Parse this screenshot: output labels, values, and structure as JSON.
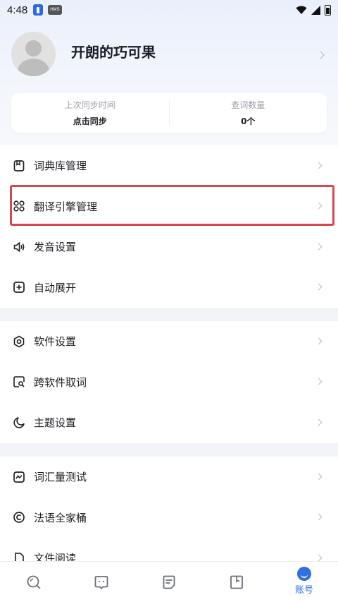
{
  "status_bar": {
    "time": "4:48",
    "hms_label": "HMS"
  },
  "profile": {
    "username": "开朗的巧可果"
  },
  "stats": [
    {
      "label": "上次同步时间",
      "value": "点击同步"
    },
    {
      "label": "查词数量",
      "value": "0个"
    }
  ],
  "section1": [
    {
      "label": "词典库管理",
      "icon": "book-box-icon"
    },
    {
      "label": "翻译引擎管理",
      "icon": "grid-apps-icon"
    },
    {
      "label": "发音设置",
      "icon": "speaker-icon"
    },
    {
      "label": "自动展开",
      "icon": "plus-box-icon"
    }
  ],
  "section2": [
    {
      "label": "软件设置",
      "icon": "hexagon-gear-icon"
    },
    {
      "label": "跨软件取词",
      "icon": "search-doc-icon"
    },
    {
      "label": "主题设置",
      "icon": "moon-icon"
    }
  ],
  "section3": [
    {
      "label": "词汇量测试",
      "icon": "trend-box-icon"
    },
    {
      "label": "法语全家桶",
      "icon": "target-c-icon"
    },
    {
      "label": "文件阅读",
      "icon": "file-icon"
    }
  ],
  "bottom_nav": {
    "active_label": "账号",
    "items": [
      "search-icon",
      "chat-face-icon",
      "notes-icon",
      "book-open-icon",
      "account-icon"
    ]
  },
  "colors": {
    "accent": "#2f6fe4",
    "highlight": "#d9474d"
  }
}
